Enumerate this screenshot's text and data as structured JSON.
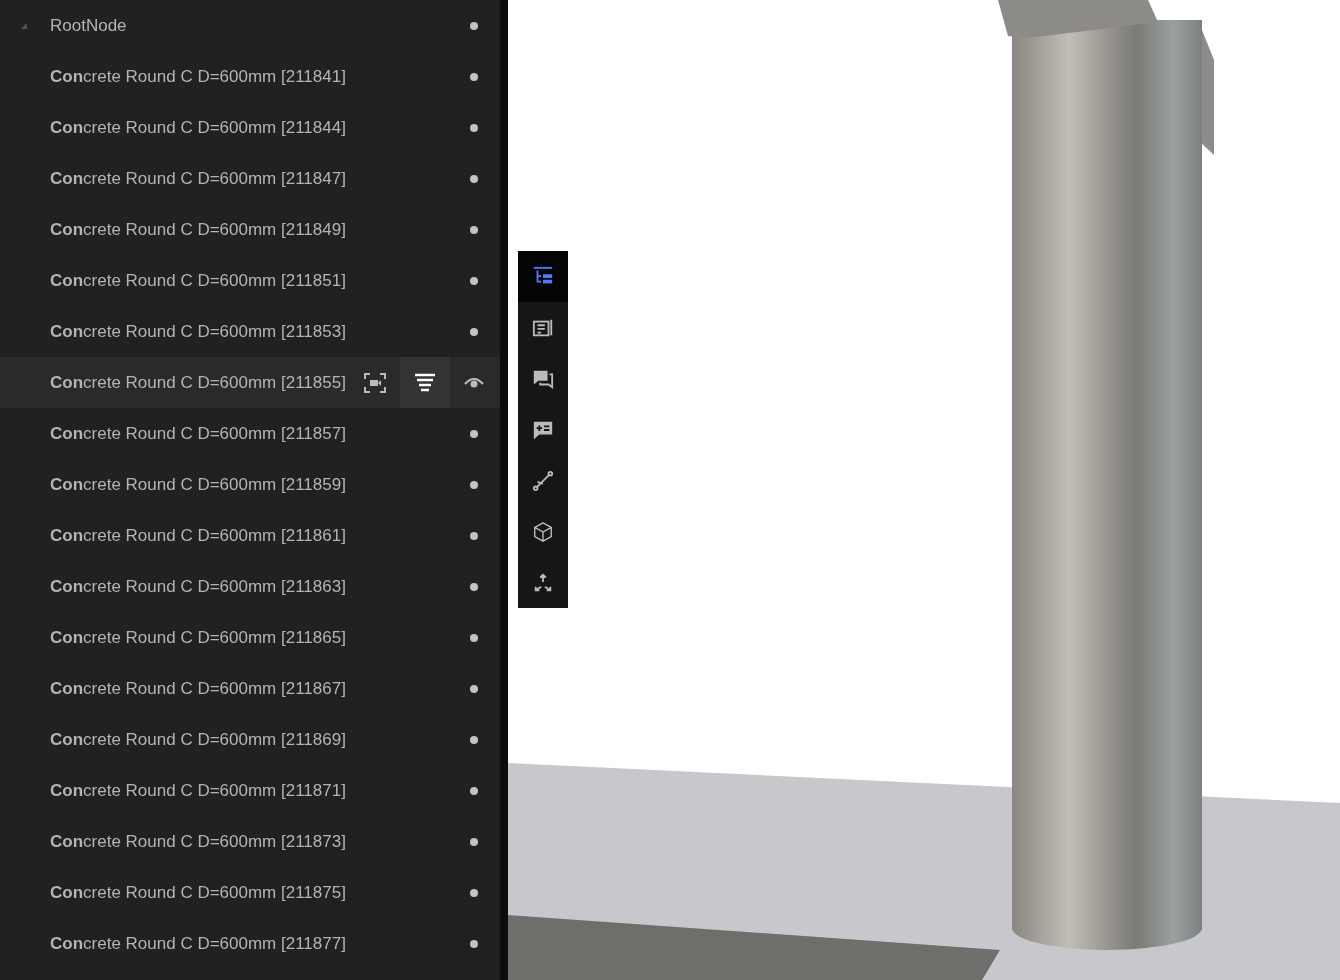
{
  "tree": {
    "root": {
      "label": "RootNode",
      "expanded": true,
      "children": [
        {
          "label": "**Con**crete Round C D=600mm [211841]",
          "hovered": false
        },
        {
          "label": "**Con**crete Round C D=600mm [211844]",
          "hovered": false
        },
        {
          "label": "**Con**crete Round C D=600mm [211847]",
          "hovered": false
        },
        {
          "label": "**Con**crete Round C D=600mm [211849]",
          "hovered": false
        },
        {
          "label": "**Con**crete Round C D=600mm [211851]",
          "hovered": false
        },
        {
          "label": "**Con**crete Round C D=600mm [211853]",
          "hovered": false
        },
        {
          "label": "**Con**crete Round C D=600mm [211855]",
          "hovered": true
        },
        {
          "label": "**Con**crete Round C D=600mm [211857]",
          "hovered": false
        },
        {
          "label": "**Con**crete Round C D=600mm [211859]",
          "hovered": false
        },
        {
          "label": "**Con**crete Round C D=600mm [211861]",
          "hovered": false
        },
        {
          "label": "**Con**crete Round C D=600mm [211863]",
          "hovered": false
        },
        {
          "label": "**Con**crete Round C D=600mm [211865]",
          "hovered": false
        },
        {
          "label": "**Con**crete Round C D=600mm [211867]",
          "hovered": false
        },
        {
          "label": "**Con**crete Round C D=600mm [211869]",
          "hovered": false
        },
        {
          "label": "**Con**crete Round C D=600mm [211871]",
          "hovered": false
        },
        {
          "label": "**Con**crete Round C D=600mm [211873]",
          "hovered": false
        },
        {
          "label": "**Con**crete Round C D=600mm [211875]",
          "hovered": false
        },
        {
          "label": "**Con**crete Round C D=600mm [211877]",
          "hovered": false
        }
      ]
    }
  },
  "toolbar": [
    {
      "kind": "tree",
      "selected": true
    },
    {
      "kind": "properties",
      "selected": false
    },
    {
      "kind": "comments",
      "selected": false
    },
    {
      "kind": "add-comment",
      "selected": false
    },
    {
      "kind": "measure",
      "selected": false
    },
    {
      "kind": "section-box",
      "selected": false
    },
    {
      "kind": "explode",
      "selected": false
    }
  ]
}
